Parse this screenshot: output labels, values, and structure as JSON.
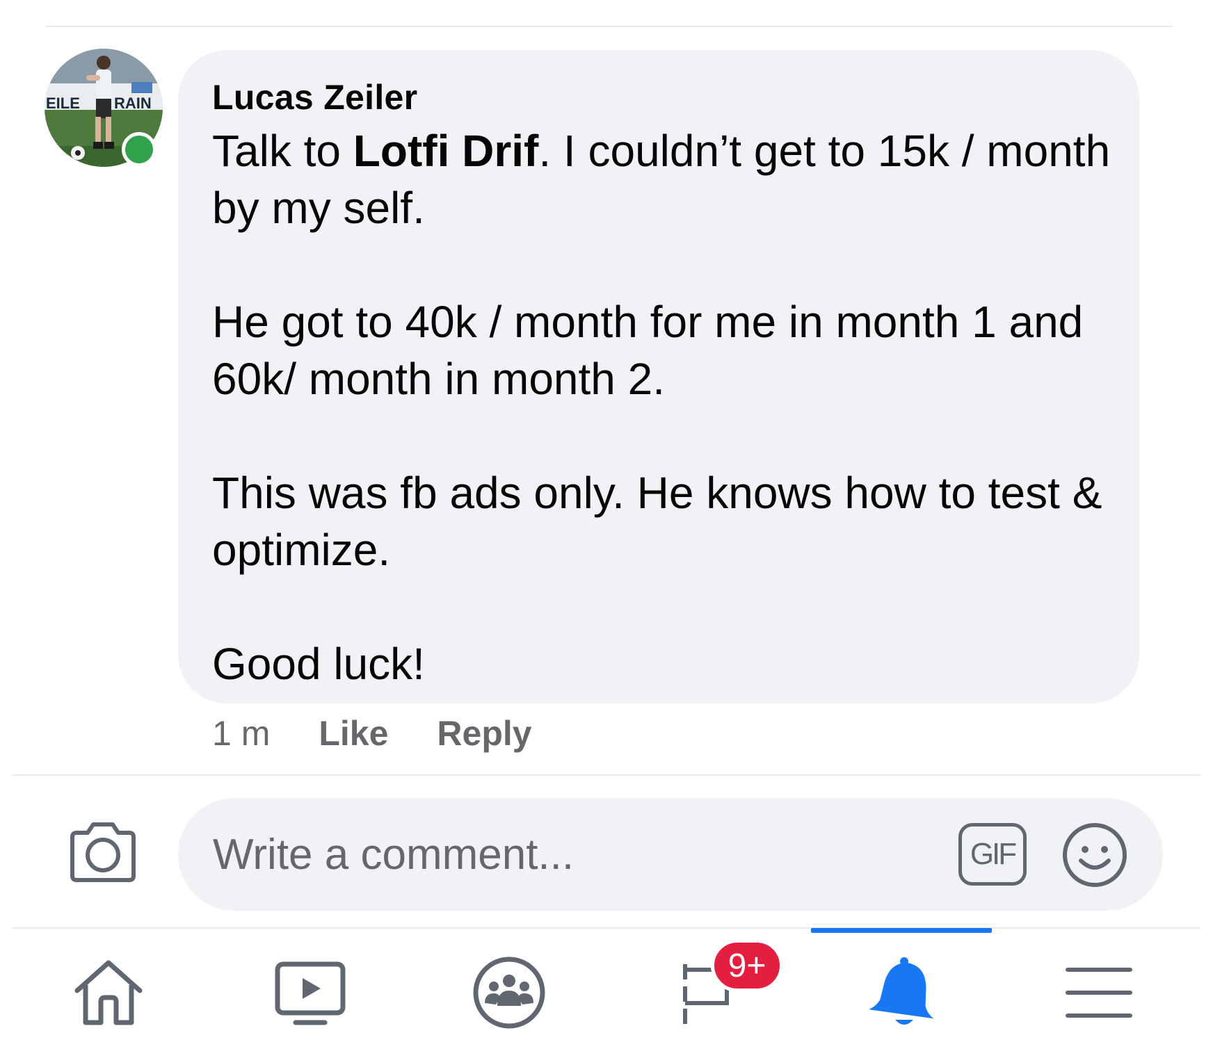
{
  "comment": {
    "author": "Lucas Zeiler",
    "author_online": true,
    "paragraphs": [
      {
        "before": "Talk to ",
        "mention": "Lotfi Drif",
        "after": ". I couldn’t get to 15k / month by my self."
      },
      {
        "text": "He got to 40k / month for me in month 1 and 60k/ month in month 2."
      },
      {
        "text": "This was fb ads only. He knows how to test & optimize."
      },
      {
        "text": "Good luck!"
      }
    ],
    "timestamp": "1 m",
    "like_label": "Like",
    "reply_label": "Reply"
  },
  "composer": {
    "placeholder": "Write a comment...",
    "gif_label": "GIF"
  },
  "nav": {
    "items": [
      {
        "icon": "home-icon"
      },
      {
        "icon": "watch-icon"
      },
      {
        "icon": "groups-icon"
      },
      {
        "icon": "pages-flag-icon",
        "badge": "9+"
      },
      {
        "icon": "notifications-bell-icon",
        "active": true
      },
      {
        "icon": "menu-icon"
      }
    ]
  },
  "colors": {
    "accent": "#1877f2",
    "badge": "#e41e3f",
    "online": "#31a24c",
    "bubble": "#f0f2f5",
    "muted_text": "#65676b"
  }
}
